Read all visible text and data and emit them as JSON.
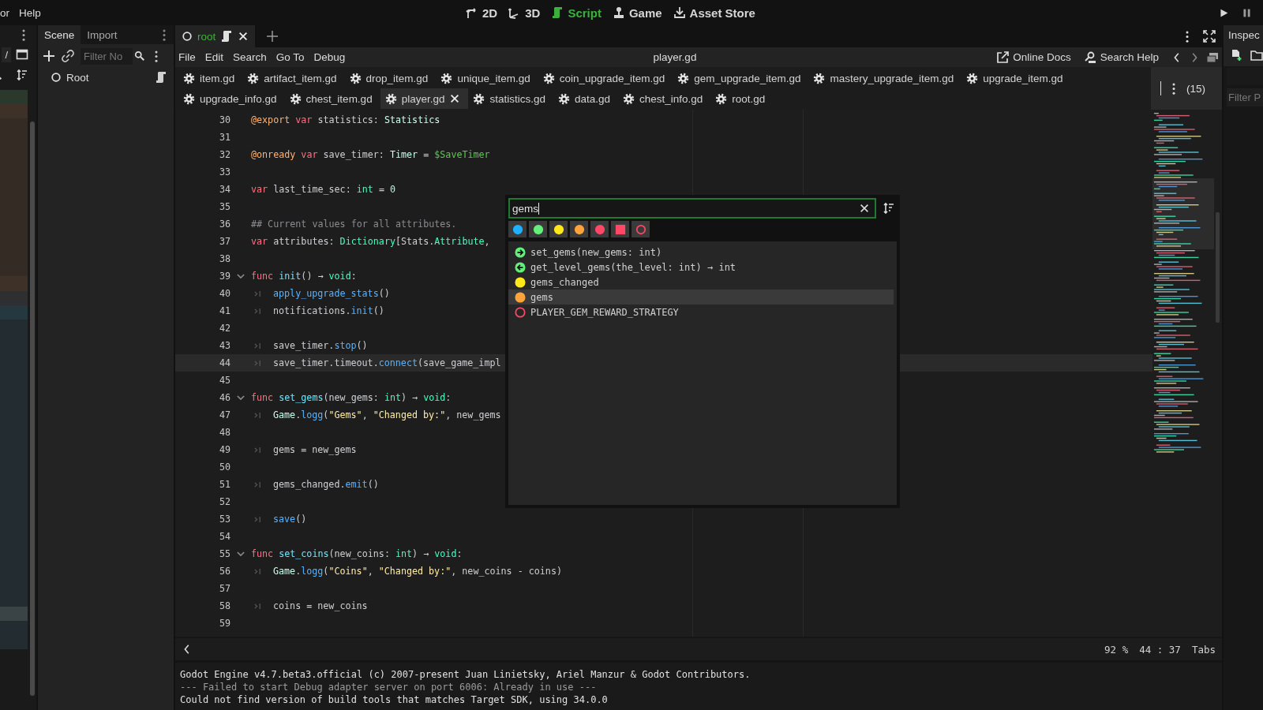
{
  "menu_bar": {
    "items": [
      "or",
      "Help"
    ]
  },
  "workspaces": [
    {
      "label": "2D",
      "kind": "flat",
      "selected": false
    },
    {
      "label": "3D",
      "kind": "spatial",
      "selected": false
    },
    {
      "label": "Script",
      "kind": "script",
      "selected": true
    },
    {
      "label": "Game",
      "kind": "game",
      "selected": false
    },
    {
      "label": "Asset Store",
      "kind": "store",
      "selected": false
    }
  ],
  "left_dock": {
    "path": "/",
    "rows": [
      {
        "color": "#2a392b"
      },
      {
        "color": "#3e3128"
      },
      {
        "color": "#352b25"
      },
      {
        "color": "#352b25"
      },
      {
        "color": "#352b25"
      },
      {
        "color": "#352b25"
      },
      {
        "color": "#352b25"
      },
      {
        "color": "#352b25"
      },
      {
        "color": "#352b25"
      },
      {
        "color": "#352b25"
      },
      {
        "color": "#352b25"
      },
      {
        "color": "#352b25"
      },
      {
        "color": "#352b25"
      },
      {
        "color": "#3e3128"
      },
      {
        "color": "#2e2f30"
      },
      {
        "color": "#26383f"
      },
      {
        "color": "#232c30"
      },
      {
        "color": "#232c30"
      },
      {
        "color": "#232c30"
      },
      {
        "color": "#232c30"
      },
      {
        "color": "#232c30"
      },
      {
        "color": "#232c30"
      },
      {
        "color": "#232c30"
      },
      {
        "color": "#232c30"
      },
      {
        "color": "#232c30"
      },
      {
        "color": "#232c30"
      },
      {
        "color": "#232c30"
      },
      {
        "color": "#232c30"
      },
      {
        "color": "#232c30"
      },
      {
        "color": "#232c30"
      },
      {
        "color": "#232c30"
      },
      {
        "color": "#232c30"
      },
      {
        "color": "#232c30"
      },
      {
        "color": "#232c30"
      },
      {
        "color": "#232c30"
      },
      {
        "color": "#232c30"
      },
      {
        "color": "#3a4446"
      },
      {
        "color": "#232c30"
      },
      {
        "color": "#232c30"
      }
    ]
  },
  "scene_dock": {
    "tabs": [
      {
        "label": "Scene",
        "selected": true
      },
      {
        "label": "Import",
        "selected": false
      }
    ],
    "filter": {
      "placeholder": "Filter No"
    },
    "tree": [
      {
        "label": "Root",
        "has_script": true
      }
    ]
  },
  "script_editor": {
    "scene_tabs": [
      {
        "label": "root",
        "selected": true
      }
    ],
    "menus": [
      "File",
      "Edit",
      "Search",
      "Go To",
      "Debug"
    ],
    "title": "player.gd",
    "help_buttons": [
      {
        "label": "Online Docs",
        "kind": "docs"
      },
      {
        "label": "Search Help",
        "kind": "help"
      }
    ],
    "script_tab_rows": [
      [
        {
          "label": "item.gd",
          "selected": false
        },
        {
          "label": "artifact_item.gd",
          "selected": false
        },
        {
          "label": "drop_item.gd",
          "selected": false
        },
        {
          "label": "unique_item.gd",
          "selected": false
        },
        {
          "label": "coin_upgrade_item.gd",
          "selected": false
        },
        {
          "label": "gem_upgrade_item.gd",
          "selected": false
        },
        {
          "label": "mastery_upgrade_item.gd",
          "selected": false
        },
        {
          "label": "upgrade_item.gd",
          "selected": false
        }
      ],
      [
        {
          "label": "upgrade_info.gd",
          "selected": false
        },
        {
          "label": "chest_item.gd",
          "selected": false
        },
        {
          "label": "player.gd",
          "selected": true
        },
        {
          "label": "statistics.gd",
          "selected": false
        },
        {
          "label": "data.gd",
          "selected": false
        },
        {
          "label": "chest_info.gd",
          "selected": false
        },
        {
          "label": "root.gd",
          "selected": false
        }
      ]
    ],
    "script_count": "(15)",
    "code": [
      {
        "number": "30",
        "fold": false,
        "indented": false,
        "current": false,
        "tokens": [
          {
            "text": "@export ",
            "kind": "ann"
          },
          {
            "text": "var",
            "kind": "kw"
          },
          {
            "text": " statistics: ",
            "kind": "plain"
          },
          {
            "text": "Statistics",
            "kind": "cls"
          }
        ]
      },
      {
        "number": "31",
        "fold": false,
        "indented": false,
        "current": false
      },
      {
        "number": "32",
        "fold": false,
        "indented": false,
        "current": false,
        "tokens": [
          {
            "text": "@onready ",
            "kind": "ann"
          },
          {
            "text": "var",
            "kind": "kw"
          },
          {
            "text": " save_timer: ",
            "kind": "plain"
          },
          {
            "text": "Timer",
            "kind": "cls"
          },
          {
            "text": " = ",
            "kind": "plain"
          },
          {
            "text": "$SaveTimer",
            "kind": "node"
          }
        ]
      },
      {
        "number": "33",
        "fold": false,
        "indented": false,
        "current": false
      },
      {
        "number": "34",
        "fold": false,
        "indented": false,
        "current": false,
        "tokens": [
          {
            "text": "var",
            "kind": "kw"
          },
          {
            "text": " last_time_sec: ",
            "kind": "plain"
          },
          {
            "text": "int",
            "kind": "type"
          },
          {
            "text": " = ",
            "kind": "plain"
          },
          {
            "text": "0",
            "kind": "num"
          }
        ]
      },
      {
        "number": "35",
        "fold": false,
        "indented": false,
        "current": false
      },
      {
        "number": "36",
        "fold": false,
        "indented": false,
        "current": false,
        "tokens": [
          {
            "text": "## Current values for all attributes.",
            "kind": "comment"
          }
        ]
      },
      {
        "number": "37",
        "fold": false,
        "indented": false,
        "current": false,
        "tokens": [
          {
            "text": "var",
            "kind": "kw"
          },
          {
            "text": " attributes: ",
            "kind": "plain"
          },
          {
            "text": "Dictionary",
            "kind": "type"
          },
          {
            "text": "[Stats.",
            "kind": "plain"
          },
          {
            "text": "Attribute",
            "kind": "type"
          },
          {
            "text": ",",
            "kind": "plain"
          }
        ]
      },
      {
        "number": "38",
        "fold": false,
        "indented": false,
        "current": false
      },
      {
        "number": "39",
        "fold": true,
        "indented": false,
        "current": false,
        "tokens": [
          {
            "text": "func ",
            "kind": "kw"
          },
          {
            "text": "init",
            "kind": "fndef"
          },
          {
            "text": "() → ",
            "kind": "plain"
          },
          {
            "text": "void",
            "kind": "type"
          },
          {
            "text": ":",
            "kind": "plain"
          }
        ]
      },
      {
        "number": "40",
        "fold": false,
        "indented": true,
        "current": false,
        "tokens": [
          {
            "text": "apply_upgrade_stats",
            "kind": "fn"
          },
          {
            "text": "()",
            "kind": "plain"
          }
        ]
      },
      {
        "number": "41",
        "fold": false,
        "indented": true,
        "current": false,
        "tokens": [
          {
            "text": "notifications.",
            "kind": "plain"
          },
          {
            "text": "init",
            "kind": "fn"
          },
          {
            "text": "()",
            "kind": "plain"
          }
        ]
      },
      {
        "number": "42",
        "fold": false,
        "indented": false,
        "current": false
      },
      {
        "number": "43",
        "fold": false,
        "indented": true,
        "current": false,
        "tokens": [
          {
            "text": "save_timer.",
            "kind": "plain"
          },
          {
            "text": "stop",
            "kind": "fn"
          },
          {
            "text": "()",
            "kind": "plain"
          }
        ]
      },
      {
        "number": "44",
        "fold": false,
        "indented": true,
        "current": true,
        "tokens": [
          {
            "text": "save_timer.timeout.",
            "kind": "plain"
          },
          {
            "text": "connect",
            "kind": "fn"
          },
          {
            "text": "(save_game_impl",
            "kind": "plain"
          }
        ]
      },
      {
        "number": "45",
        "fold": false,
        "indented": false,
        "current": false
      },
      {
        "number": "46",
        "fold": true,
        "indented": false,
        "current": false,
        "tokens": [
          {
            "text": "func ",
            "kind": "kw"
          },
          {
            "text": "set_gems",
            "kind": "fndef"
          },
          {
            "text": "(new_gems: ",
            "kind": "plain"
          },
          {
            "text": "int",
            "kind": "type"
          },
          {
            "text": ") → ",
            "kind": "plain"
          },
          {
            "text": "void",
            "kind": "type"
          },
          {
            "text": ":",
            "kind": "plain"
          }
        ]
      },
      {
        "number": "47",
        "fold": false,
        "indented": true,
        "current": false,
        "tokens": [
          {
            "text": "Game",
            "kind": "cls"
          },
          {
            "text": ".",
            "kind": "plain"
          },
          {
            "text": "logg",
            "kind": "fn"
          },
          {
            "text": "(",
            "kind": "plain"
          },
          {
            "text": "\"Gems\"",
            "kind": "str"
          },
          {
            "text": ", ",
            "kind": "plain"
          },
          {
            "text": "\"Changed by:\"",
            "kind": "str"
          },
          {
            "text": ", new_gems",
            "kind": "plain"
          }
        ]
      },
      {
        "number": "48",
        "fold": false,
        "indented": false,
        "current": false
      },
      {
        "number": "49",
        "fold": false,
        "indented": true,
        "current": false,
        "tokens": [
          {
            "text": "gems = new_gems",
            "kind": "plain"
          }
        ]
      },
      {
        "number": "50",
        "fold": false,
        "indented": false,
        "current": false
      },
      {
        "number": "51",
        "fold": false,
        "indented": true,
        "current": false,
        "tokens": [
          {
            "text": "gems_changed.",
            "kind": "plain"
          },
          {
            "text": "emit",
            "kind": "fn"
          },
          {
            "text": "()",
            "kind": "plain"
          }
        ]
      },
      {
        "number": "52",
        "fold": false,
        "indented": false,
        "current": false
      },
      {
        "number": "53",
        "fold": false,
        "indented": true,
        "current": false,
        "tokens": [
          {
            "text": "save",
            "kind": "fn"
          },
          {
            "text": "()",
            "kind": "plain"
          }
        ]
      },
      {
        "number": "54",
        "fold": false,
        "indented": false,
        "current": false
      },
      {
        "number": "55",
        "fold": true,
        "indented": false,
        "current": false,
        "tokens": [
          {
            "text": "func ",
            "kind": "kw"
          },
          {
            "text": "set_coins",
            "kind": "fndef"
          },
          {
            "text": "(new_coins: ",
            "kind": "plain"
          },
          {
            "text": "int",
            "kind": "type"
          },
          {
            "text": ") → ",
            "kind": "plain"
          },
          {
            "text": "void",
            "kind": "type"
          },
          {
            "text": ":",
            "kind": "plain"
          }
        ]
      },
      {
        "number": "56",
        "fold": false,
        "indented": true,
        "current": false,
        "tokens": [
          {
            "text": "Game",
            "kind": "cls"
          },
          {
            "text": ".",
            "kind": "plain"
          },
          {
            "text": "logg",
            "kind": "fn"
          },
          {
            "text": "(",
            "kind": "plain"
          },
          {
            "text": "\"Coins\"",
            "kind": "str"
          },
          {
            "text": ", ",
            "kind": "plain"
          },
          {
            "text": "\"Changed by:\"",
            "kind": "str"
          },
          {
            "text": ", new_coins - coins)",
            "kind": "plain"
          }
        ]
      },
      {
        "number": "57",
        "fold": false,
        "indented": false,
        "current": false
      },
      {
        "number": "58",
        "fold": false,
        "indented": true,
        "current": false,
        "tokens": [
          {
            "text": "coins = new_coins",
            "kind": "plain"
          }
        ]
      },
      {
        "number": "59",
        "fold": false,
        "indented": false,
        "current": false
      }
    ],
    "autocomplete": {
      "query": "gems",
      "filters": [
        {
          "kind": "dot",
          "color": "#1fb0ff"
        },
        {
          "kind": "dot",
          "color": "#63f07a"
        },
        {
          "kind": "dot",
          "color": "#ffe81a"
        },
        {
          "kind": "dot",
          "color": "#ffa33a"
        },
        {
          "kind": "dot",
          "color": "#ff4766"
        },
        {
          "kind": "square",
          "color": "#ff4766"
        },
        {
          "kind": "ring",
          "color": "#ff4766"
        }
      ],
      "items": [
        {
          "label": "set_gems(new_gems: int)",
          "kind": "method",
          "selected": false
        },
        {
          "label": "get_level_gems(the_level: int) → int",
          "kind": "inherited",
          "selected": false
        },
        {
          "label": "gems_changed",
          "kind": "signal",
          "selected": false
        },
        {
          "label": "gems",
          "kind": "member",
          "selected": true
        },
        {
          "label": "PLAYER_GEM_REWARD_STRATEGY",
          "kind": "constant",
          "selected": false
        }
      ]
    },
    "status": {
      "zoom": "92 %",
      "position": "44 : 37",
      "indent_mode": "Tabs"
    }
  },
  "output": {
    "lines": [
      {
        "text": "Godot Engine v4.7.beta3.official (c) 2007-present Juan Linietsky, Ariel Manzur & Godot Contributors.",
        "kind": "info"
      },
      {
        "text": "--- Failed to start Debug adapter server on port 6006: Already in use ---",
        "kind": "faint"
      },
      {
        "text": "Could not find version of build tools that matches Target SDK, using 34.0.0",
        "kind": "info"
      }
    ]
  },
  "inspector": {
    "tab": "Inspec",
    "filter": {
      "placeholder": "Filter P"
    }
  }
}
